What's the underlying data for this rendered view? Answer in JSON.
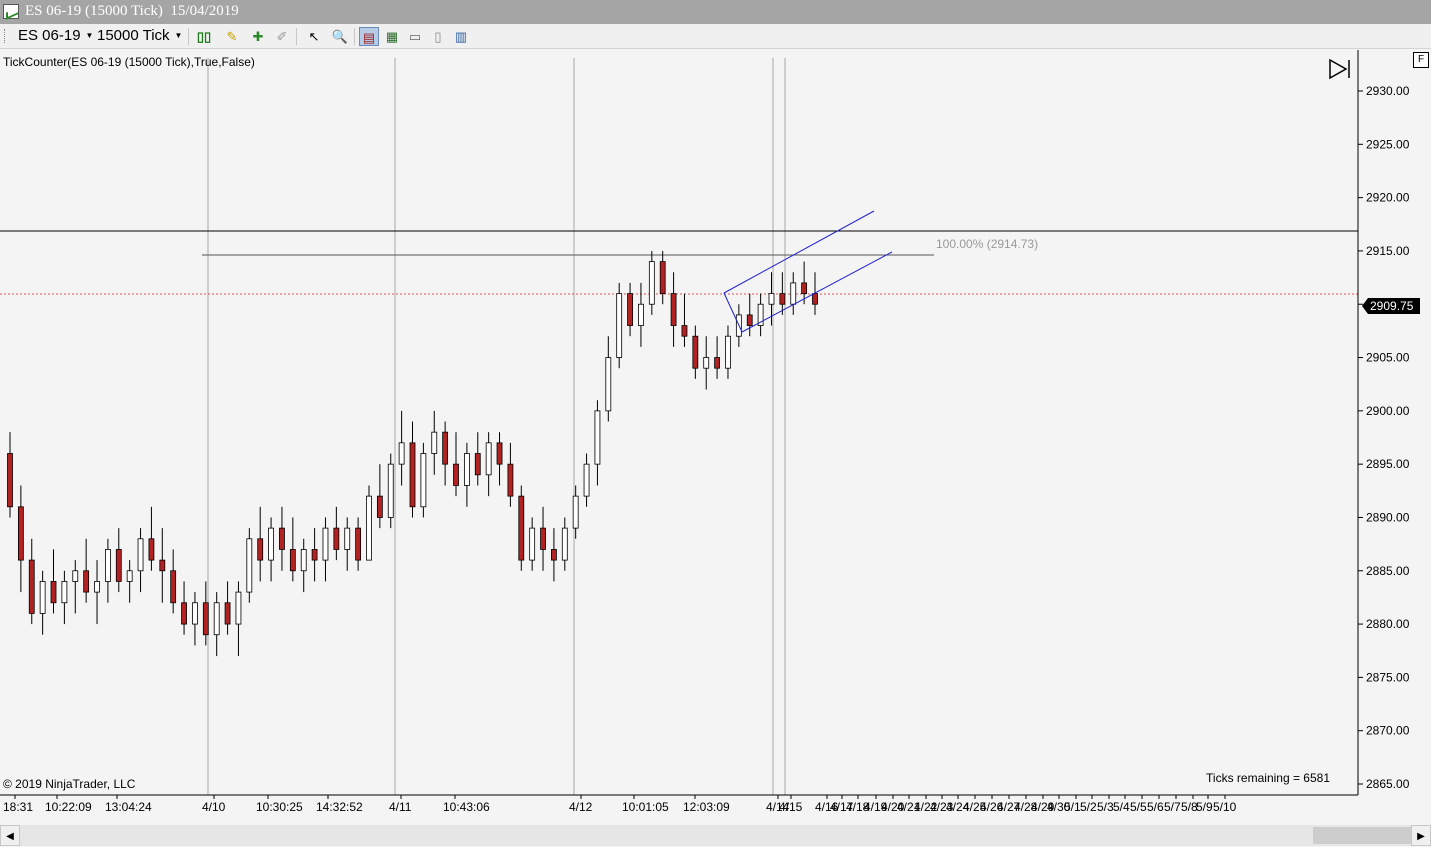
{
  "window": {
    "title": "ES 06-19 (15000 Tick)  15/04/2019"
  },
  "toolbar": {
    "instrument": "ES 06-19",
    "interval": "15000 Tick",
    "buttons": [
      "bar-style-icon",
      "draw-tool-icon",
      "add-tool-icon",
      "hide-tools-icon",
      "cursor-icon",
      "zoom-icon",
      "chart-trader-icon",
      "indicators-icon",
      "strategies-icon",
      "data-box-icon",
      "properties-icon"
    ]
  },
  "indicator": {
    "label": "TickCounter(ES  06-19 (15000  Tick),True,False)"
  },
  "footer": {
    "copyright": "© 2019 NinjaTrader, LLC",
    "ticks_remaining": "Ticks remaining = 6581"
  },
  "f_button": "F",
  "chart_data": {
    "type": "candlestick",
    "price_axis": {
      "ticks": [
        "2930.00",
        "2925.00",
        "2920.00",
        "2915.00",
        "2910.00",
        "2905.00",
        "2900.00",
        "2895.00",
        "2890.00",
        "2885.00",
        "2880.00",
        "2875.00",
        "2870.00",
        "2865.00"
      ],
      "range": [
        2865,
        2931
      ]
    },
    "last_price": "2909.75",
    "fib_label": "100.00% (2914.73)",
    "time_labels": [
      "18:31",
      "10:22:09",
      "13:04:24",
      "4/10",
      "10:30:25",
      "14:32:52",
      "4/11",
      "10:43:06",
      "4/12",
      "10:01:05",
      "12:03:09",
      "4/14",
      "4/15",
      "4/16",
      "4/17",
      "4/18",
      "4/19",
      "4/20",
      "4/21",
      "4/22",
      "4/23",
      "4/24",
      "4/25",
      "4/26",
      "4/27",
      "4/28",
      "4/29",
      "4/30",
      "5/1",
      "5/2",
      "5/3",
      "5/4",
      "5/5",
      "5/6",
      "5/7",
      "5/8",
      "5/9",
      "5/10"
    ],
    "candles": [
      [
        2896,
        2898,
        2890,
        2891
      ],
      [
        2891,
        2893,
        2883,
        2886
      ],
      [
        2886,
        2888,
        2880,
        2881
      ],
      [
        2881,
        2885,
        2879,
        2884
      ],
      [
        2884,
        2887,
        2881,
        2882
      ],
      [
        2882,
        2885,
        2880,
        2884
      ],
      [
        2884,
        2886,
        2881,
        2885
      ],
      [
        2885,
        2888,
        2882,
        2883
      ],
      [
        2883,
        2886,
        2880,
        2884
      ],
      [
        2884,
        2888,
        2882,
        2887
      ],
      [
        2887,
        2889,
        2883,
        2884
      ],
      [
        2884,
        2886,
        2882,
        2885
      ],
      [
        2885,
        2889,
        2883,
        2888
      ],
      [
        2888,
        2891,
        2885,
        2886
      ],
      [
        2886,
        2889,
        2882,
        2885
      ],
      [
        2885,
        2887,
        2881,
        2882
      ],
      [
        2882,
        2884,
        2879,
        2880
      ],
      [
        2880,
        2883,
        2878,
        2882
      ],
      [
        2882,
        2884,
        2878,
        2879
      ],
      [
        2879,
        2883,
        2877,
        2882
      ],
      [
        2882,
        2884,
        2879,
        2880
      ],
      [
        2880,
        2884,
        2877,
        2883
      ],
      [
        2883,
        2889,
        2882,
        2888
      ],
      [
        2888,
        2891,
        2884,
        2886
      ],
      [
        2886,
        2890,
        2884,
        2889
      ],
      [
        2889,
        2891,
        2885,
        2887
      ],
      [
        2887,
        2890,
        2884,
        2885
      ],
      [
        2885,
        2888,
        2883,
        2887
      ],
      [
        2887,
        2889,
        2884,
        2886
      ],
      [
        2886,
        2890,
        2884,
        2889
      ],
      [
        2889,
        2891,
        2886,
        2887
      ],
      [
        2887,
        2890,
        2885,
        2889
      ],
      [
        2889,
        2890,
        2885,
        2886
      ],
      [
        2886,
        2893,
        2886,
        2892
      ],
      [
        2892,
        2895,
        2889,
        2890
      ],
      [
        2890,
        2896,
        2889,
        2895
      ],
      [
        2895,
        2900,
        2893,
        2897
      ],
      [
        2897,
        2899,
        2890,
        2891
      ],
      [
        2891,
        2897,
        2890,
        2896
      ],
      [
        2896,
        2900,
        2894,
        2898
      ],
      [
        2898,
        2899,
        2893,
        2895
      ],
      [
        2895,
        2898,
        2892,
        2893
      ],
      [
        2893,
        2897,
        2891,
        2896
      ],
      [
        2896,
        2898,
        2893,
        2894
      ],
      [
        2894,
        2898,
        2892,
        2897
      ],
      [
        2897,
        2898,
        2893,
        2895
      ],
      [
        2895,
        2897,
        2891,
        2892
      ],
      [
        2892,
        2893,
        2885,
        2886
      ],
      [
        2886,
        2890,
        2885,
        2889
      ],
      [
        2889,
        2891,
        2885,
        2887
      ],
      [
        2887,
        2889,
        2884,
        2886
      ],
      [
        2886,
        2890,
        2885,
        2889
      ],
      [
        2889,
        2893,
        2888,
        2892
      ],
      [
        2892,
        2896,
        2891,
        2895
      ],
      [
        2895,
        2901,
        2893,
        2900
      ],
      [
        2900,
        2907,
        2899,
        2905
      ],
      [
        2905,
        2912,
        2904,
        2911
      ],
      [
        2911,
        2912,
        2907,
        2908
      ],
      [
        2908,
        2912,
        2906,
        2910
      ],
      [
        2910,
        2915,
        2909,
        2914
      ],
      [
        2914,
        2915,
        2910,
        2911
      ],
      [
        2911,
        2913,
        2906,
        2908
      ],
      [
        2908,
        2911,
        2906,
        2907
      ],
      [
        2907,
        2908,
        2903,
        2904
      ],
      [
        2904,
        2907,
        2902,
        2905
      ],
      [
        2905,
        2907,
        2903,
        2904
      ],
      [
        2904,
        2908,
        2903,
        2907
      ],
      [
        2907,
        2910,
        2906,
        2909
      ],
      [
        2909,
        2911,
        2907,
        2908
      ],
      [
        2908,
        2911,
        2907,
        2910
      ],
      [
        2910,
        2913,
        2908,
        2911
      ],
      [
        2911,
        2913,
        2909,
        2910
      ],
      [
        2910,
        2913,
        2909,
        2912
      ],
      [
        2912,
        2914,
        2910,
        2911
      ],
      [
        2911,
        2913,
        2909,
        2910
      ]
    ]
  }
}
